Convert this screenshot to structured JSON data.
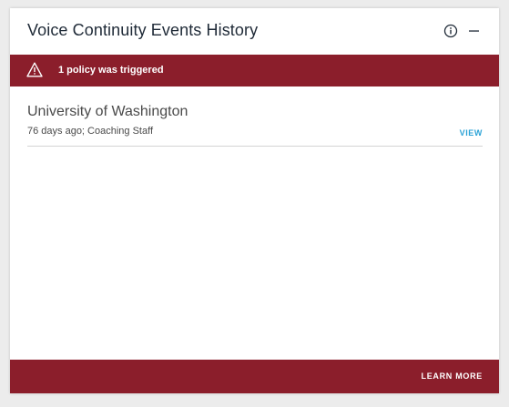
{
  "widget": {
    "title": "Voice Continuity Events History",
    "info_icon": "info-circle-icon",
    "minimize_icon": "minus-icon"
  },
  "alert": {
    "icon": "warning-triangle-icon",
    "text": "1 policy was triggered",
    "color": "#8b1e2b"
  },
  "events": [
    {
      "title": "University of Washington",
      "meta": "76 days ago; Coaching Staff",
      "action_label": "VIEW"
    }
  ],
  "footer": {
    "link_label": "LEARN MORE",
    "color": "#8b1e2b"
  },
  "colors": {
    "accent_link": "#2aa2d6",
    "brand": "#8b1e2b"
  }
}
